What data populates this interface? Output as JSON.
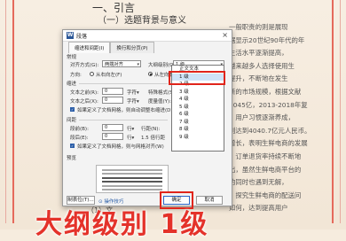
{
  "document": {
    "heading1": "一、引言",
    "heading2": "（一）选题背景与意义",
    "paragraph_lines": [
      "一般职责的则是展现",
      "据显示20世纪90年代的年",
      "生活水平逐渐提高，",
      "越来越多人选择使用生",
      "提升，不断地在发生",
      "新的市场规模，根据文献",
      "2045亿，2013-2018年复",
      "，用户习惯逐渐养成，",
      "则达到4040.7亿元人民币。",
      "增长，表明生鲜电商的发展",
      "，订单退货率持续不断地",
      "出，虽然生鲜电商平台的",
      "的同时也遇到无解，",
      "，探究生鲜电商的配送问",
      "如何，达到提高用户"
    ],
    "footer": "（1）文"
  },
  "dialog": {
    "title": "段落",
    "close": "×",
    "tabs": [
      "缩进和间距(I)",
      "换行和分页(P)"
    ],
    "section_general": "常规",
    "alignment_label": "对齐方式(G):",
    "alignment_value": "两端对齐",
    "outline_label": "大纲级别(O):",
    "outline_value": "1 级",
    "direction_label": "方向:",
    "direction_rtl": "从右向左(F)",
    "direction_ltr": "从左向右(L)",
    "section_indent": "缩进",
    "before_text_label": "文本之前(R):",
    "before_text_value": "0",
    "after_text_label": "文本之后(X):",
    "after_text_value": "0",
    "unit": "字符▾",
    "special_label": "特殊格式(S):",
    "special_value": "(无)",
    "indent_by_label": "度量值(Y):",
    "indent_by_value": "",
    "grid_indent_check": "如果定义了文档网格，则自动调整右缩进(D)",
    "section_spacing": "间距",
    "before_label": "段前(B):",
    "before_value": "0",
    "after_label": "段后(E):",
    "after_value": "0",
    "line_unit": "行▾",
    "line_spacing_label": "行距(N):",
    "line_spacing_value": "1.5 倍行距",
    "setting_label": "设置值(A):",
    "grid_spacing_check": "如果定义了文档网格，则与网格对齐(W)",
    "section_preview": "预览",
    "tabs_button": "制表位(T)...",
    "help_link": "⊙ 操作技巧",
    "ok": "确定",
    "cancel": "取消"
  },
  "dropdown": {
    "options": [
      "正文文本",
      "1 级",
      "2 级",
      "3 级",
      "4 级",
      "5 级",
      "6 级",
      "7 级",
      "8 级",
      "9 级"
    ],
    "selected_index": 1
  },
  "colors": {
    "highlight": "#e0251b",
    "selection": "#cfe3f7",
    "accent": "#2b5797"
  },
  "caption": "大纲级别 1级"
}
